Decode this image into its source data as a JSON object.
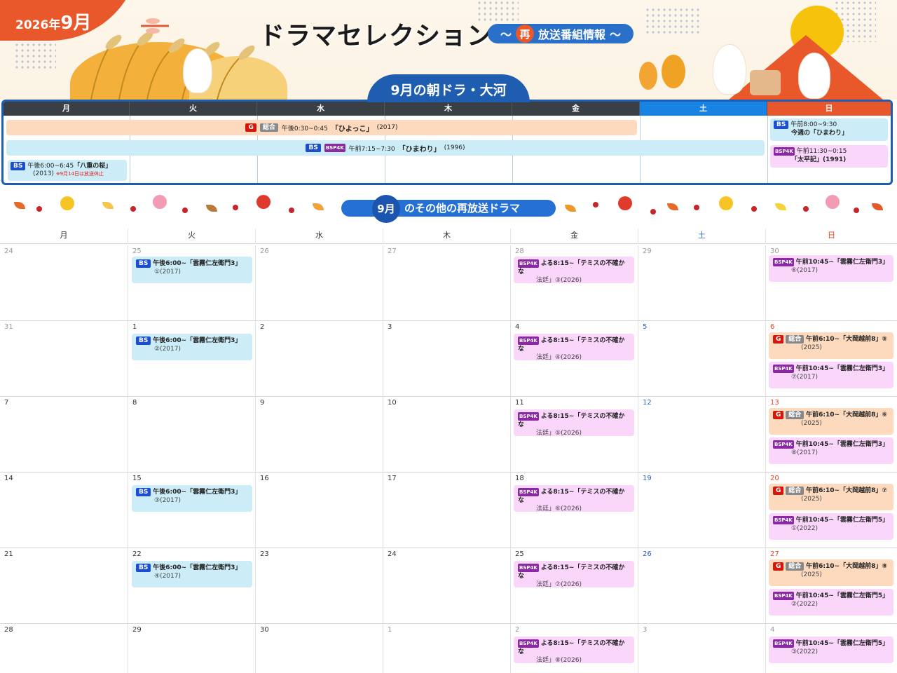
{
  "banner": {
    "year": "2026年",
    "month": "9月",
    "title": "ドラマセレクション",
    "subtitle_sai": "再",
    "subtitle_rest": "放送番組情報",
    "tilde_left": "〜",
    "tilde_right": "〜"
  },
  "section1": {
    "heading": "9月の朝ドラ・大河",
    "days": [
      "月",
      "火",
      "水",
      "木",
      "金",
      "土",
      "日"
    ],
    "programs": {
      "hiyokko": {
        "ch1": "G",
        "ch2": "総合",
        "time": "午後0:30~0:45",
        "title": "「ひよっこ」",
        "year": "(2017)"
      },
      "himawari": {
        "ch1": "BS",
        "ch2": "BSP4K",
        "time": "午前7:15~7:30",
        "title": "「ひまわり」",
        "year": "(1996)"
      },
      "yaenosakura": {
        "ch": "BS",
        "time": "午後6:00~6:45",
        "title": "「八重の桜」",
        "year": "(2013)",
        "note": "※9月14日は放送休止"
      },
      "sun_himawari": {
        "ch": "BS",
        "time": "午前8:00~9:30",
        "title": "今週の「ひまわり」"
      },
      "taiheiki": {
        "ch": "BSP4K",
        "time": "午前11:30~0:15",
        "title": "「太平記」(1991)"
      }
    }
  },
  "section2": {
    "num": "9月",
    "heading": "のその他の再放送ドラマ",
    "days": [
      "月",
      "火",
      "水",
      "木",
      "金",
      "土",
      "日"
    ]
  },
  "calendar": {
    "weeks": [
      [
        "24",
        "25",
        "26",
        "27",
        "28",
        "29",
        "30"
      ],
      [
        "31",
        "1",
        "2",
        "3",
        "4",
        "5",
        "6"
      ],
      [
        "7",
        "8",
        "9",
        "10",
        "11",
        "12",
        "13"
      ],
      [
        "14",
        "15",
        "16",
        "17",
        "18",
        "19",
        "20"
      ],
      [
        "21",
        "22",
        "23",
        "24",
        "25",
        "26",
        "27"
      ],
      [
        "28",
        "29",
        "30",
        "1",
        "2",
        "3",
        "4"
      ]
    ],
    "kumo3": [
      {
        "ch": "BS",
        "t1": "午後6:00~「雲霧仁左衛門3」",
        "t2": "①(2017)"
      },
      {
        "ch": "BS",
        "t1": "午後6:00~「雲霧仁左衛門3」",
        "t2": "②(2017)"
      },
      {
        "ch": "BS",
        "t1": "午後6:00~「雲霧仁左衛門3」",
        "t2": "③(2017)"
      },
      {
        "ch": "BS",
        "t1": "午後6:00~「雲霧仁左衛門3」",
        "t2": "④(2017)"
      }
    ],
    "themis": [
      {
        "ch": "BSP4K",
        "t1": "よる8:15~「テミスの不確かな",
        "t2": "法廷」③(2026)"
      },
      {
        "ch": "BSP4K",
        "t1": "よる8:15~「テミスの不確かな",
        "t2": "法廷」④(2026)"
      },
      {
        "ch": "BSP4K",
        "t1": "よる8:15~「テミスの不確かな",
        "t2": "法廷」⑤(2026)"
      },
      {
        "ch": "BSP4K",
        "t1": "よる8:15~「テミスの不確かな",
        "t2": "法廷」⑥(2026)"
      },
      {
        "ch": "BSP4K",
        "t1": "よる8:15~「テミスの不確かな",
        "t2": "法廷」⑦(2026)"
      },
      {
        "ch": "BSP4K",
        "t1": "よる8:15~「テミスの不確かな",
        "t2": "法廷」⑧(2026)"
      }
    ],
    "ooka": [
      {
        "ch": "G",
        "ch2": "総合",
        "t1": "午前6:10~「大岡越前8」⑤",
        "t2": "(2025)"
      },
      {
        "ch": "G",
        "ch2": "総合",
        "t1": "午前6:10~「大岡越前8」⑥",
        "t2": "(2025)"
      },
      {
        "ch": "G",
        "ch2": "総合",
        "t1": "午前6:10~「大岡越前8」⑦",
        "t2": "(2025)"
      },
      {
        "ch": "G",
        "ch2": "総合",
        "t1": "午前6:10~「大岡越前8」⑧",
        "t2": "(2025)"
      }
    ],
    "sun4k": [
      {
        "ch": "BSP4K",
        "t1": "午前10:45~「雲霧仁左衛門3」",
        "t2": "⑥(2017)"
      },
      {
        "ch": "BSP4K",
        "t1": "午前10:45~「雲霧仁左衛門3」",
        "t2": "⑦(2017)"
      },
      {
        "ch": "BSP4K",
        "t1": "午前10:45~「雲霧仁左衛門3」",
        "t2": "⑧(2017)"
      },
      {
        "ch": "BSP4K",
        "t1": "午前10:45~「雲霧仁左衛門5」",
        "t2": "①(2022)"
      },
      {
        "ch": "BSP4K",
        "t1": "午前10:45~「雲霧仁左衛門5」",
        "t2": "②(2022)"
      },
      {
        "ch": "BSP4K",
        "t1": "午前10:45~「雲霧仁左衛門5」",
        "t2": "③(2022)"
      }
    ]
  },
  "colors": {
    "accent_orange": "#e8582a",
    "brand_blue": "#1f5db0",
    "saturday_blue": "#1784e3",
    "sunday_red": "#e8562c",
    "weekday_dark": "#3a3f46",
    "slot_blue": "#ccedf7",
    "slot_pink": "#fbd6fb",
    "slot_peach": "#fdd9be"
  }
}
